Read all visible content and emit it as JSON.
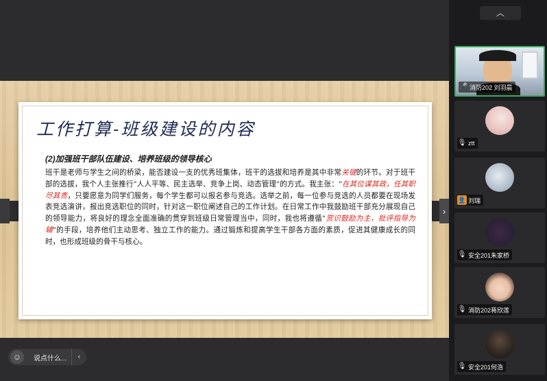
{
  "slide": {
    "title": "工作打算-班级建设的内容",
    "subheading": "(2)加强班干部队伍建设、培养班级的领导核心",
    "body_parts": [
      {
        "text": "班干是老师与学生之间的桥梁，能否建设一支的优秀班集体，班干的选拔和培养是其中非常",
        "red": false
      },
      {
        "text": "关键",
        "red": true
      },
      {
        "text": "的环节。对于班干部的选拔，我个人主张推行\"人人平等、民主选举、竞争上岗、动态管理\"的方式。我主张：\"",
        "red": false
      },
      {
        "text": "在其位谋其政，任其职尽其责",
        "red": true
      },
      {
        "text": "，只要愿意为同学们服务，每个学生都可以报名参与竞选。选举之前，每一位参与竞选的人员都要在现场发表竞选演讲，报出竞选职位的同时，针对这一职位阐述自己的工作计划。在日常工作中我鼓励班干部充分展现自己的领导能力，将良好的理念全面准确的贯穿到班级日常管理当中，同时，我也将遵循\"",
        "red": false
      },
      {
        "text": "赏识鼓励为主，批评指导为辅",
        "red": true
      },
      {
        "text": "\"的手段，培养他们主动思考、独立工作的能力。通过锻炼和提高学生干部各方面的素质，促进其健康成长的同时，也形成班级的骨干与核心。",
        "red": false
      }
    ]
  },
  "chat": {
    "emoji_icon": "emoji-icon",
    "placeholder": "说点什么..."
  },
  "panel": {
    "participants": [
      {
        "name": "消防202 刘羽晨",
        "mic": "on",
        "active": true
      },
      {
        "name": "ztt",
        "mic": "off",
        "active": false
      },
      {
        "name": "刘瑞",
        "mic": "none",
        "active": false
      },
      {
        "name": "安全201朱家桥",
        "mic": "off",
        "active": false
      },
      {
        "name": "消防202蒋欣莲",
        "mic": "off",
        "active": false
      },
      {
        "name": "安全201何浩",
        "mic": "off",
        "active": false
      }
    ]
  },
  "colors": {
    "accent_red": "#e0241d",
    "title_blue": "#1e2a55",
    "active_green": "#3aaa60"
  }
}
